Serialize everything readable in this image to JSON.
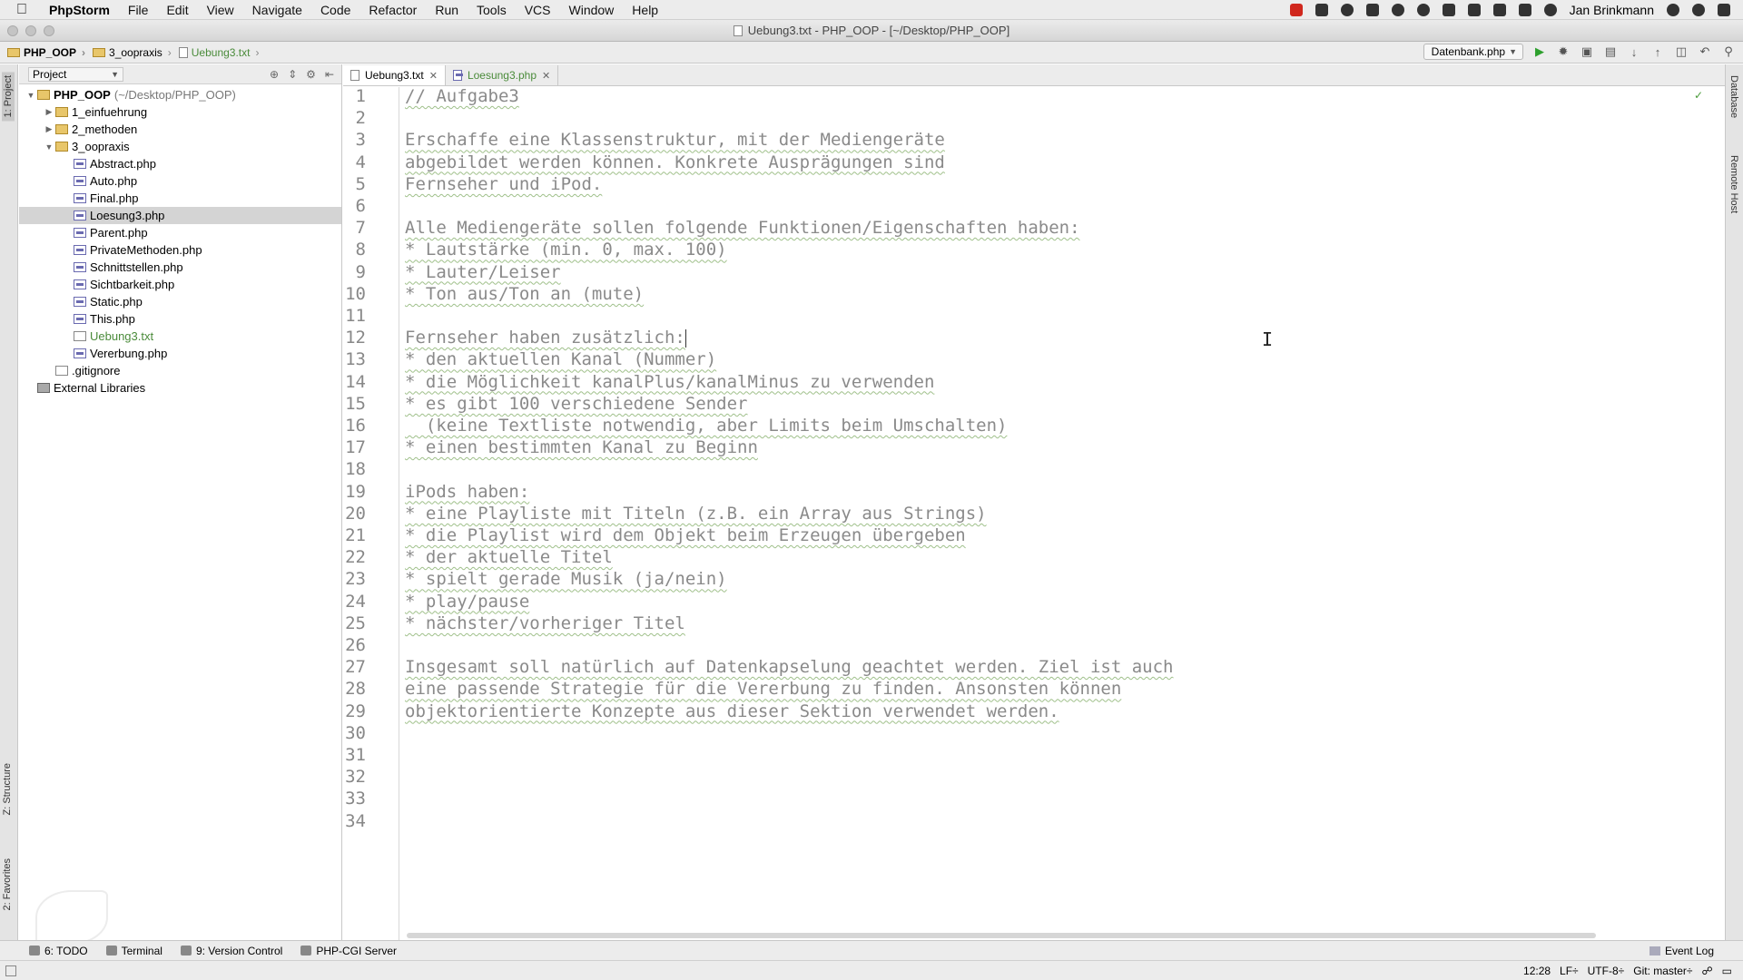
{
  "menubar": {
    "app_name": "PhpStorm",
    "items": [
      "File",
      "Edit",
      "View",
      "Navigate",
      "Code",
      "Refactor",
      "Run",
      "Tools",
      "VCS",
      "Window",
      "Help"
    ],
    "user": "Jan Brinkmann"
  },
  "window": {
    "title": "Uebung3.txt - PHP_OOP - [~/Desktop/PHP_OOP]"
  },
  "navbar": {
    "breadcrumbs": [
      "PHP_OOP",
      "3_oopraxis",
      "Uebung3.txt"
    ],
    "run_config": "Datenbank.php"
  },
  "project_panel": {
    "header": "Project",
    "tree": [
      {
        "label": "PHP_OOP",
        "extra": "(~/Desktop/PHP_OOP)",
        "type": "folder",
        "depth": 0,
        "expanded": true
      },
      {
        "label": "1_einfuehrung",
        "type": "folder",
        "depth": 1,
        "expanded": false
      },
      {
        "label": "2_methoden",
        "type": "folder",
        "depth": 1,
        "expanded": false
      },
      {
        "label": "3_oopraxis",
        "type": "folder",
        "depth": 1,
        "expanded": true
      },
      {
        "label": "Abstract.php",
        "type": "php",
        "depth": 2
      },
      {
        "label": "Auto.php",
        "type": "php",
        "depth": 2
      },
      {
        "label": "Final.php",
        "type": "php",
        "depth": 2
      },
      {
        "label": "Loesung3.php",
        "type": "php",
        "depth": 2,
        "selected": true
      },
      {
        "label": "Parent.php",
        "type": "php",
        "depth": 2
      },
      {
        "label": "PrivateMethoden.php",
        "type": "php",
        "depth": 2
      },
      {
        "label": "Schnittstellen.php",
        "type": "php",
        "depth": 2
      },
      {
        "label": "Sichtbarkeit.php",
        "type": "php",
        "depth": 2
      },
      {
        "label": "Static.php",
        "type": "php",
        "depth": 2
      },
      {
        "label": "This.php",
        "type": "php",
        "depth": 2
      },
      {
        "label": "Uebung3.txt",
        "type": "txt",
        "depth": 2,
        "green": true
      },
      {
        "label": "Vererbung.php",
        "type": "php",
        "depth": 2
      },
      {
        "label": ".gitignore",
        "type": "txt",
        "depth": 1
      },
      {
        "label": "External Libraries",
        "type": "lib",
        "depth": 0
      }
    ]
  },
  "left_strip": {
    "project": "1: Project",
    "structure": "Z: Structure",
    "favorites": "2: Favorites"
  },
  "right_strip": {
    "database": "Database",
    "remote_host": "Remote Host"
  },
  "editor_tabs": [
    {
      "label": "Uebung3.txt",
      "active": true
    },
    {
      "label": "Loesung3.php",
      "active": false
    }
  ],
  "editor": {
    "line_numbers": [
      "1",
      "2",
      "3",
      "4",
      "5",
      "6",
      "7",
      "8",
      "9",
      "10",
      "11",
      "12",
      "13",
      "14",
      "15",
      "16",
      "17",
      "18",
      "19",
      "20",
      "21",
      "22",
      "23",
      "24",
      "25",
      "26",
      "27",
      "28",
      "29",
      "30",
      "31",
      "32",
      "33",
      "34"
    ],
    "lines": [
      "// Aufgabe3",
      "",
      "Erschaffe eine Klassenstruktur, mit der Mediengeräte",
      "abgebildet werden können. Konkrete Ausprägungen sind",
      "Fernseher und iPod.",
      "",
      "Alle Mediengeräte sollen folgende Funktionen/Eigenschaften haben:",
      "* Lautstärke (min. 0, max. 100)",
      "* Lauter/Leiser",
      "* Ton aus/Ton an (mute)",
      "",
      "Fernseher haben zusätzlich:",
      "* den aktuellen Kanal (Nummer)",
      "* die Möglichkeit kanalPlus/kanalMinus zu verwenden",
      "* es gibt 100 verschiedene Sender",
      "  (keine Textliste notwendig, aber Limits beim Umschalten)",
      "* einen bestimmten Kanal zu Beginn",
      "",
      "iPods haben:",
      "* eine Playliste mit Titeln (z.B. ein Array aus Strings)",
      "* die Playlist wird dem Objekt beim Erzeugen übergeben",
      "* der aktuelle Titel",
      "* spielt gerade Musik (ja/nein)",
      "* play/pause",
      "* nächster/vorheriger Titel",
      "",
      "Insgesamt soll natürlich auf Datenkapselung geachtet werden. Ziel ist auch",
      "eine passende Strategie für die Vererbung zu finden. Ansonsten können",
      "objektorientierte Konzepte aus dieser Sektion verwendet werden.",
      "",
      "",
      "",
      "",
      ""
    ]
  },
  "bottom_tools": [
    "6: TODO",
    "Terminal",
    "9: Version Control",
    "PHP-CGI Server"
  ],
  "event_log": "Event Log",
  "status": {
    "position": "12:28",
    "line_sep": "LF÷",
    "encoding": "UTF-8÷",
    "git": "Git: master÷"
  },
  "colors": {
    "accent_green": "#4a8b3a",
    "run_green": "#2ea02e",
    "editor_text": "#8a8a8a"
  }
}
